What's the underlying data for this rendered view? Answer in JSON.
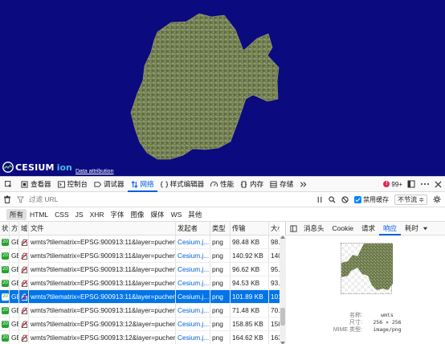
{
  "viewer": {
    "logo_brand": "CESIUM",
    "logo_suffix": "ion",
    "data_attribution": "Data attribution",
    "background_color": "#0b0a7f"
  },
  "devtools": {
    "tabs": [
      {
        "label": "查看器",
        "icon": "inspector-icon"
      },
      {
        "label": "控制台",
        "icon": "console-icon"
      },
      {
        "label": "调试器",
        "icon": "debugger-icon"
      },
      {
        "label": "网络",
        "icon": "network-icon",
        "active": true
      },
      {
        "label": "样式编辑器",
        "icon": "style-editor-icon"
      },
      {
        "label": "性能",
        "icon": "performance-icon"
      },
      {
        "label": "内存",
        "icon": "memory-icon"
      },
      {
        "label": "存储",
        "icon": "storage-icon"
      }
    ],
    "error_count": "99+",
    "filter_placeholder": "过滤 URL",
    "disable_cache_label": "禁用缓存",
    "throttle_label": "不节流 ≑",
    "type_filters": [
      "所有",
      "HTML",
      "CSS",
      "JS",
      "XHR",
      "字体",
      "图像",
      "媒体",
      "WS",
      "其他"
    ],
    "active_type_filter": "所有",
    "columns": {
      "status": "状",
      "method": "方",
      "domain": "域",
      "file": "文件",
      "initiator": "发起者",
      "type": "类型",
      "transferred": "传输",
      "size": "大小"
    },
    "rows": [
      {
        "method": "GE",
        "file": "wmts?tilematrix=EPSG:900913:11&layer=pucheng:",
        "initiator": "Cesium.j...",
        "type": "png",
        "transferred": "98.48 KB",
        "size": "98.",
        "selected": false
      },
      {
        "method": "GE",
        "file": "wmts?tilematrix=EPSG:900913:11&layer=pucheng:",
        "initiator": "Cesium.j...",
        "type": "png",
        "transferred": "140.92 KB",
        "size": "140",
        "selected": false
      },
      {
        "method": "GE",
        "file": "wmts?tilematrix=EPSG:900913:11&layer=pucheng:",
        "initiator": "Cesium.j...",
        "type": "png",
        "transferred": "96.62 KB",
        "size": "95.",
        "selected": false
      },
      {
        "method": "GE",
        "file": "wmts?tilematrix=EPSG:900913:11&layer=pucheng:",
        "initiator": "Cesium.j...",
        "type": "png",
        "transferred": "94.53 KB",
        "size": "93.",
        "selected": false
      },
      {
        "method": "GE",
        "file": "wmts?tilematrix=EPSG:900913:11&layer=pucheng:",
        "initiator": "Cesium.j...",
        "type": "png",
        "transferred": "101.89 KB",
        "size": "101",
        "selected": true
      },
      {
        "method": "GE",
        "file": "wmts?tilematrix=EPSG:900913:11&layer=pucheng:",
        "initiator": "Cesium.j...",
        "type": "png",
        "transferred": "71.48 KB",
        "size": "70.",
        "selected": false
      },
      {
        "method": "GE",
        "file": "wmts?tilematrix=EPSG:900913:12&layer=pucheng:",
        "initiator": "Cesium.j...",
        "type": "png",
        "transferred": "158.85 KB",
        "size": "158",
        "selected": false
      },
      {
        "method": "GE",
        "file": "wmts?tilematrix=EPSG:900913:12&layer=pucheng:",
        "initiator": "Cesium.j...",
        "type": "png",
        "transferred": "164.62 KB",
        "size": "163",
        "selected": false
      },
      {
        "method": "GE",
        "file": "wmts?tilematrix=EPSG:900913:12&layer=pucheng:",
        "initiator": "Cesium.j...",
        "type": "png",
        "transferred": "164.18 KB",
        "size": "163",
        "selected": false
      }
    ],
    "status_code_short": "20",
    "detail_tabs": [
      "消息头",
      "Cookie",
      "请求",
      "响应",
      "耗时"
    ],
    "active_detail_tab": "响应",
    "response_meta": {
      "name_label": "名称:",
      "name_value": "wmts",
      "dimension_label": "尺寸:",
      "dimension_value": "256 × 256",
      "mime_label": "MIME 类型:",
      "mime_value": "image/png"
    }
  }
}
